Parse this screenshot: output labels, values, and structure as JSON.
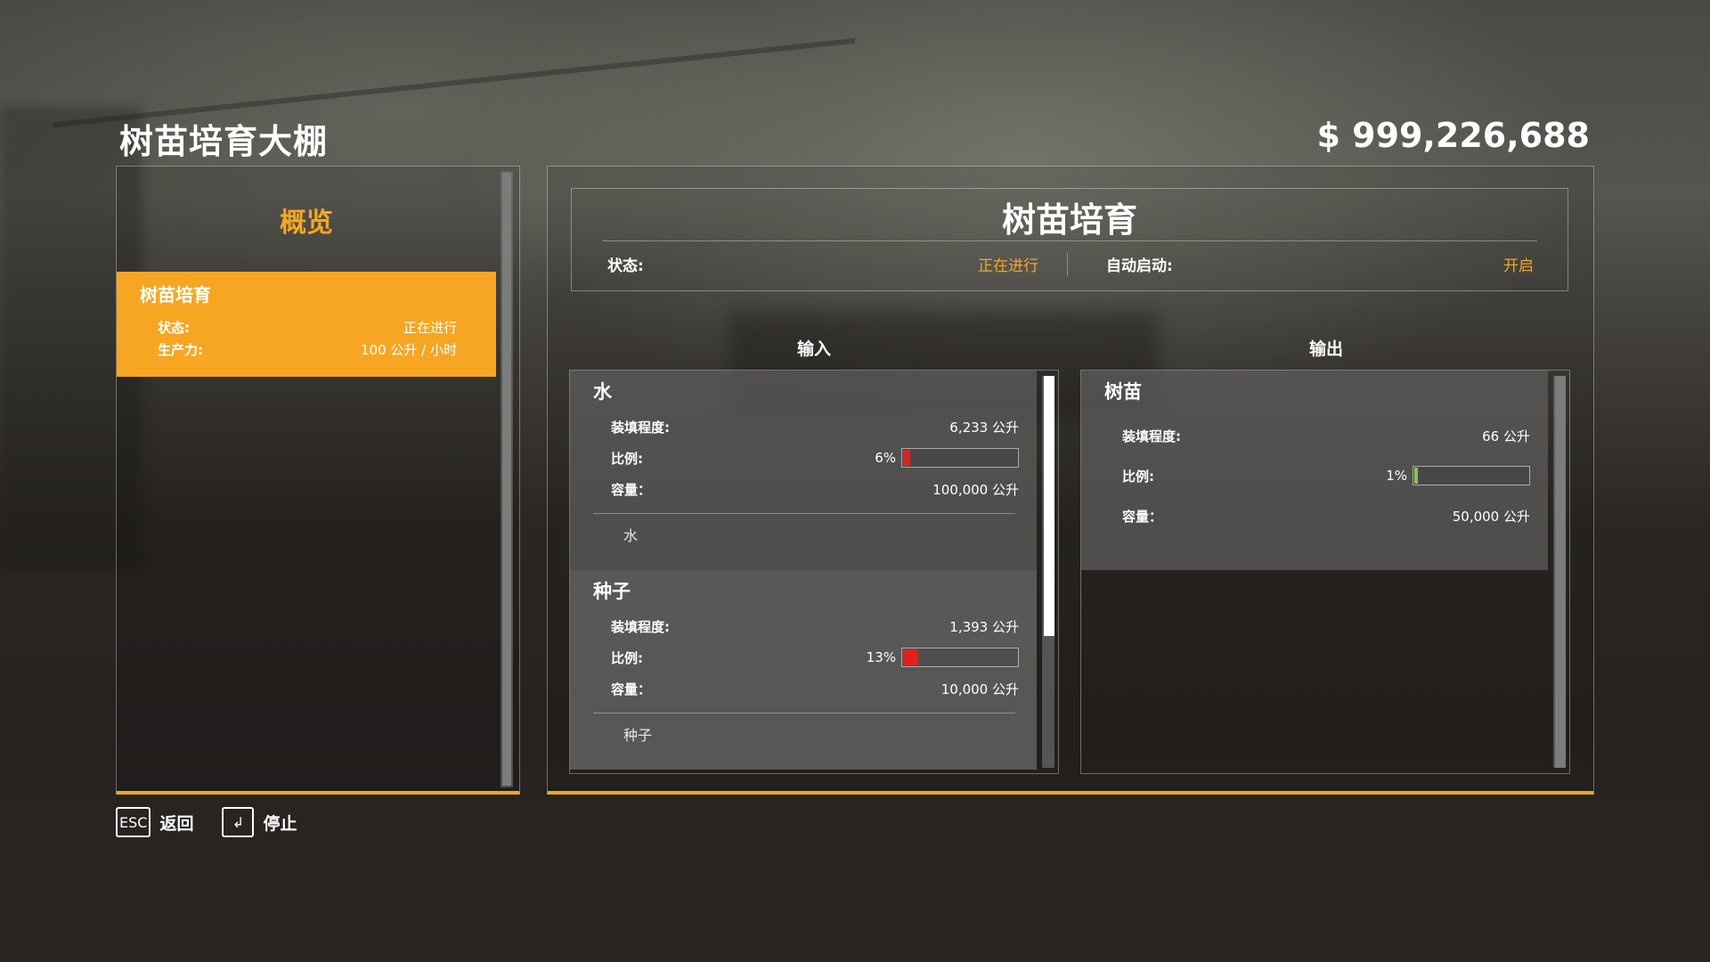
{
  "header": {
    "title": "树苗培育大棚",
    "money": "$ 999,226,688"
  },
  "sidebar": {
    "heading": "概览",
    "items": [
      {
        "name": "树苗培育",
        "status_label": "状态:",
        "status_value": "正在进行",
        "productivity_label": "生产力:",
        "productivity_value": "100 公升 / 小时"
      }
    ]
  },
  "production": {
    "title": "树苗培育",
    "status_label": "状态:",
    "status_value": "正在进行",
    "autostart_label": "自动启动:",
    "autostart_value": "开启"
  },
  "inputs": {
    "label": "输入",
    "items": [
      {
        "name": "水",
        "fill_label": "装填程度:",
        "fill_value": "6,233 公升",
        "ratio_label": "比例:",
        "ratio_value": "6%",
        "ratio_fraction": 0.06,
        "capacity_label": "容量：",
        "capacity_value": "100,000 公升",
        "type": "水"
      },
      {
        "name": "种子",
        "fill_label": "装填程度:",
        "fill_value": "1,393 公升",
        "ratio_label": "比例:",
        "ratio_value": "13%",
        "ratio_fraction": 0.13,
        "capacity_label": "容量：",
        "capacity_value": "10,000 公升",
        "type": "种子"
      }
    ]
  },
  "outputs": {
    "label": "输出",
    "items": [
      {
        "name": "树苗",
        "fill_label": "装填程度:",
        "fill_value": "66 公升",
        "ratio_label": "比例:",
        "ratio_value": "1%",
        "ratio_fraction": 0.01,
        "capacity_label": "容量：",
        "capacity_value": "50,000 公升"
      }
    ]
  },
  "footer": {
    "back_key": "ESC",
    "back_label": "返回",
    "stop_key": "↲",
    "stop_label": "停止"
  },
  "colors": {
    "accent": "#f6a623",
    "ratio_low": "#e02020",
    "ratio_output": "#8bc34a"
  }
}
